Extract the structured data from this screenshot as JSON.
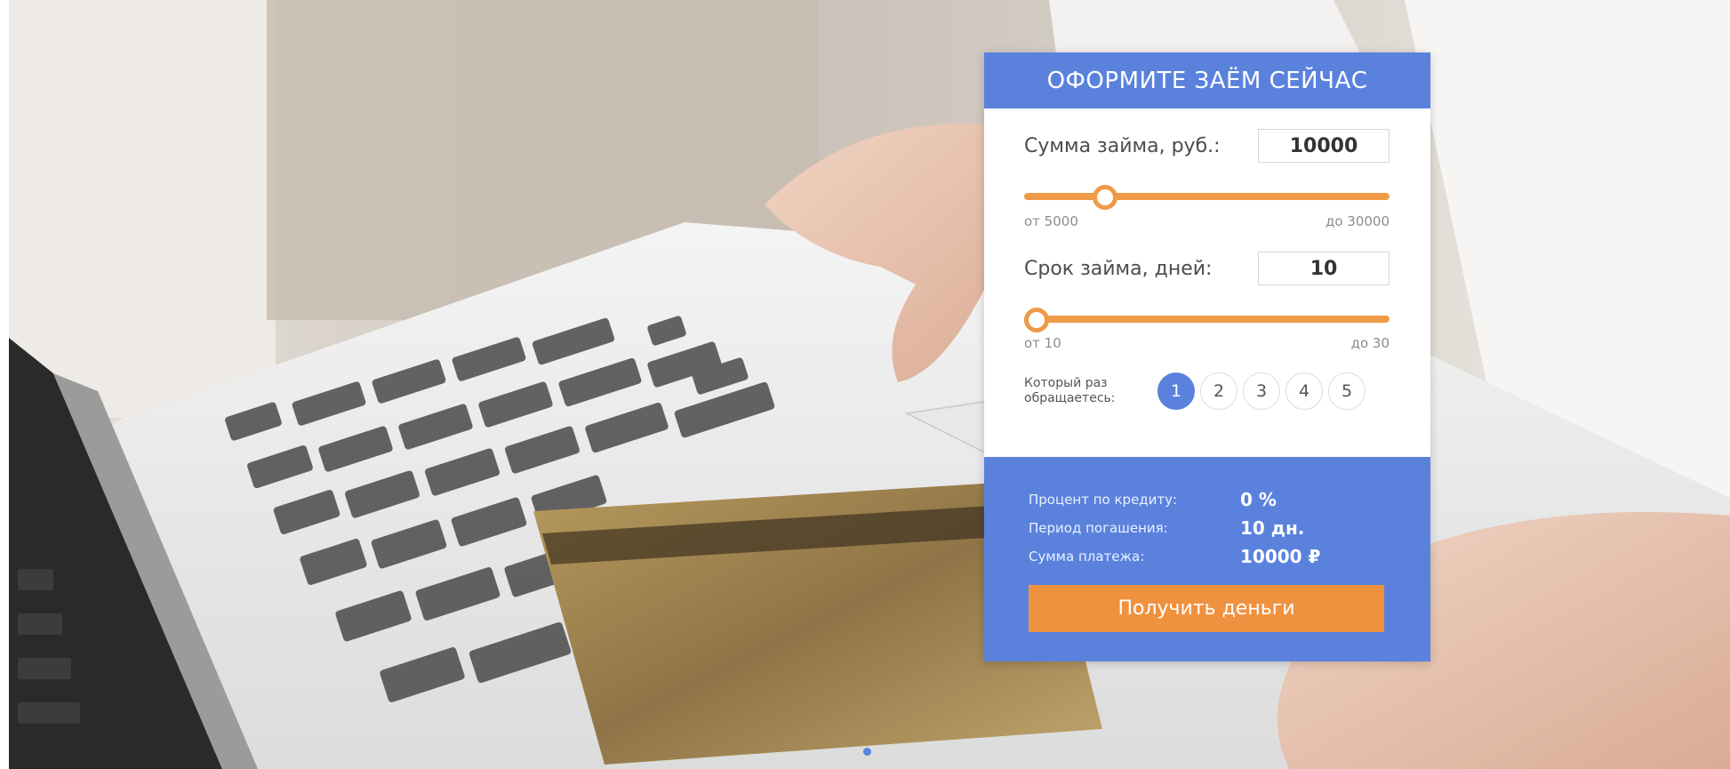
{
  "form": {
    "title": "ОФОРМИТЕ ЗАЁМ СЕЙЧАС",
    "amount": {
      "label": "Сумма займа, руб.:",
      "value": "10000",
      "min_label": "от 5000",
      "max_label": "до 30000",
      "min": 5000,
      "max": 30000,
      "current": 10000
    },
    "term": {
      "label": "Срок займа, дней:",
      "value": "10",
      "min_label": "от 10",
      "max_label": "до 30",
      "min": 10,
      "max": 30,
      "current": 10
    },
    "visits": {
      "label_line1": "Который раз",
      "label_line2": "обращаетесь:",
      "options": [
        "1",
        "2",
        "3",
        "4",
        "5"
      ],
      "selected": "1"
    },
    "summary": {
      "rate_label": "Процент по кредиту:",
      "rate_value": "0 %",
      "period_label": "Период погашения:",
      "period_value": "10 дн.",
      "payment_label": "Сумма платежа:",
      "payment_value": "10000 ₽"
    },
    "submit_label": "Получить деньги"
  },
  "colors": {
    "header_blue": "#5a82dd",
    "accent_orange": "#ef9240"
  }
}
